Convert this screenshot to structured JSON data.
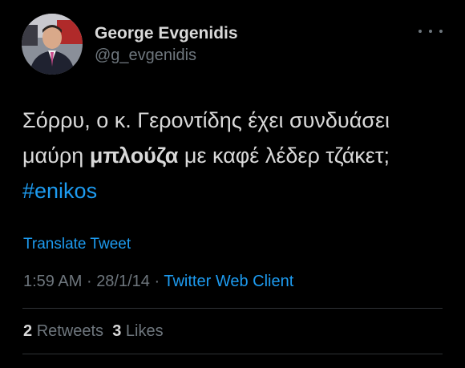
{
  "author": {
    "name": "George Evgenidis",
    "handle": "@g_evgenidis"
  },
  "tweet": {
    "text_part1": "Σόρρυ, ο κ. Γεροντίδης έχει συνδυάσει μαύρη ",
    "text_bold": "μπλούζα",
    "text_part2": " με καφέ λέδερ τζάκετ; ",
    "hashtag": "#enikos",
    "translate_label": "Translate Tweet",
    "time": "1:59 AM",
    "date": "28/1/14",
    "separator": "·",
    "source": "Twitter Web Client"
  },
  "stats": {
    "retweets_count": "2",
    "retweets_label": "Retweets",
    "likes_count": "3",
    "likes_label": "Likes"
  },
  "icons": {
    "more": "more-options-icon"
  },
  "colors": {
    "background": "#000000",
    "primary_text": "#d9d9d9",
    "secondary_text": "#6e767d",
    "link": "#1d9bf0",
    "divider": "#2f3336"
  }
}
